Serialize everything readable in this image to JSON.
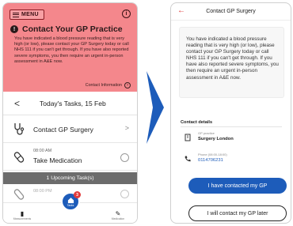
{
  "left_screen": {
    "menu_label": "MENU",
    "info_glyph": "i",
    "alert": {
      "warn_glyph": "!",
      "title": "Contact Your GP Practice",
      "body": "You have indicated a blood pressure reading that is very high (or low), please contact your GP Surgery today or call NHS 111 if you can't get through. If you have also reported severe symptoms, you then require an urgent in-person assessment in A&E now.",
      "contact_link": "Contact Information",
      "background": "#f4878c"
    },
    "tasks_header": {
      "back_glyph": "<",
      "date": "Today's Tasks, 15 Feb"
    },
    "tasks": [
      {
        "label": "Contact GP Surgery",
        "chevron": ">"
      },
      {
        "time": "08:00 AM",
        "label": "Take Medication"
      }
    ],
    "upcoming_label": "1 Upcoming Task(s)",
    "faded_task_time": "08:00 PM",
    "bottom_nav": {
      "left_caption": "Measurements",
      "center_caption": "Tasks",
      "center_badge": "3",
      "right_caption": "Medication"
    }
  },
  "right_screen": {
    "back_glyph": "←",
    "title": "Contact GP Surgery",
    "body": "You have indicated a blood pressure reading that is very high (or low), please contact your GP Surgery today or call NHS 111 if you can't get through. If you have also reported severe symptoms, you then require an urgent in-person assessment in A&E now.",
    "contact_details_heading": "Contact details",
    "practice_label": "GP practice",
    "practice_name": "Surgery London",
    "phone_label": "Phone (08:00-18:00)",
    "phone_number": "0114706231",
    "primary_button": "I have contacted my GP",
    "secondary_button": "I will contact my GP later"
  },
  "colors": {
    "accent_blue": "#1d5cba",
    "alert_red": "#f4878c",
    "badge_red": "#e23a3a",
    "arrow_blue": "#1d5cba"
  },
  "icons": {
    "menu": "hamburger-icon",
    "info": "info-icon",
    "warning": "warning-icon",
    "stethoscope": "stethoscope-icon",
    "pill": "pill-icon",
    "home": "home-icon",
    "phone": "phone-icon",
    "building": "building-icon"
  }
}
